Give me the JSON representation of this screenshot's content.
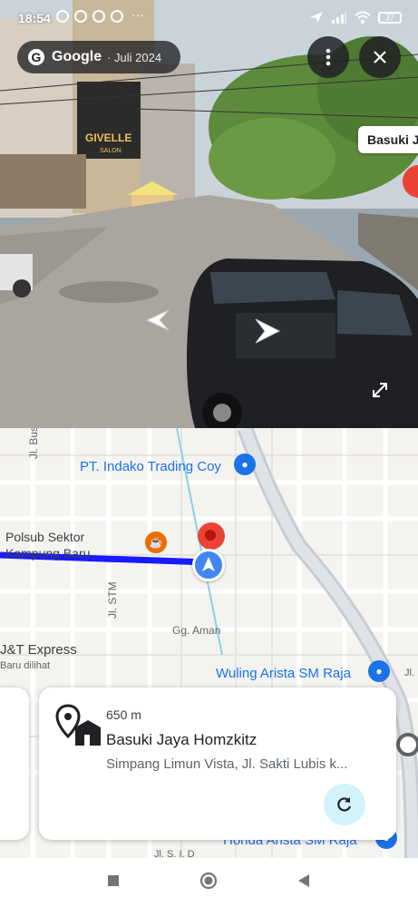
{
  "status_bar": {
    "time": "18:54",
    "battery": "37"
  },
  "street_view": {
    "brand": "Google",
    "date": "· Juli 2024",
    "place_label": "Basuki J",
    "sign_text": "GIVELLE",
    "sign_subtext": "SALON",
    "icons": [
      "more-vert-icon",
      "close-icon",
      "fullscreen-icon",
      "arrow-left-icon",
      "arrow-right-icon"
    ]
  },
  "map": {
    "poi_indako": "PT. Indako Trading Coy",
    "poi_polsub_line1": "Polsub Sektor",
    "poi_polsub_line2": "Kampung Baru",
    "street_busi": "Jl. Busi",
    "street_stm": "Jl. STM",
    "street_aman": "Gg. Aman",
    "poi_jnt": "J&T Express",
    "poi_jnt_sub": "Baru dilihat",
    "poi_wuling": "Wuling Arista SM Raja",
    "poi_honda": "Honda Arista SM Raja",
    "street_edge_right": "Jl.",
    "street_bottom": "Jl. S. I. D",
    "route_color": "#1a1aff",
    "location_color": "#4285f4",
    "pin_color": "#ea4335"
  },
  "place_card": {
    "distance": "650 m",
    "name": "Basuki Jaya Homzkitz",
    "address": "Simpang Limun Vista, Jl. Sakti Lubis k..."
  }
}
